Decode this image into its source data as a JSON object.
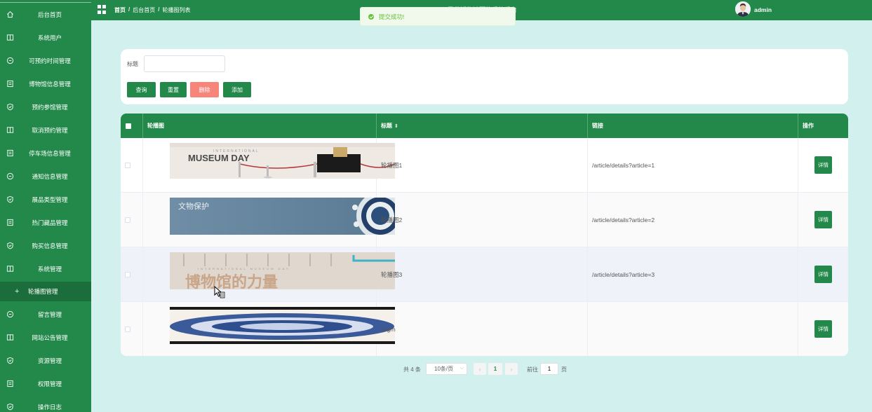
{
  "app": {
    "site_title": "民俗博物馆预约系统后台",
    "user": "admin"
  },
  "breadcrumb": [
    "首页",
    "后台首页",
    "轮播图列表"
  ],
  "toast": {
    "message": "提交成功!"
  },
  "sidebar": {
    "items": [
      {
        "label": "后台首页",
        "icon": "home-icon"
      },
      {
        "label": "系统用户",
        "icon": "grid-icon"
      },
      {
        "label": "可预约时间管理",
        "icon": "chat-icon"
      },
      {
        "label": "博物馆信息管理",
        "icon": "doc-icon"
      },
      {
        "label": "预约参馆管理",
        "icon": "shield-icon"
      },
      {
        "label": "取消预约管理",
        "icon": "grid-icon"
      },
      {
        "label": "停车场信息管理",
        "icon": "doc-icon"
      },
      {
        "label": "通知信息管理",
        "icon": "chat-icon"
      },
      {
        "label": "展品类型管理",
        "icon": "shield-icon"
      },
      {
        "label": "热门藏品管理",
        "icon": "doc-icon"
      },
      {
        "label": "购买信息管理",
        "icon": "shield-icon"
      },
      {
        "label": "系统管理",
        "icon": "grid-icon"
      },
      {
        "label": "轮播图管理",
        "icon": "plus-icon",
        "active": true
      },
      {
        "label": "留言管理",
        "icon": "chat-icon"
      },
      {
        "label": "网站公告管理",
        "icon": "grid-icon"
      },
      {
        "label": "资源管理",
        "icon": "shield-icon"
      },
      {
        "label": "权限管理",
        "icon": "doc-icon"
      },
      {
        "label": "操作日志",
        "icon": "shield-icon"
      }
    ]
  },
  "search": {
    "label": "标题",
    "value": "",
    "placeholder": ""
  },
  "buttons": {
    "query": "查询",
    "reset": "重置",
    "delete": "删除",
    "add": "添加"
  },
  "table": {
    "headers": {
      "image": "轮播图",
      "title": "标题",
      "link": "链接",
      "action": "操作"
    },
    "rows": [
      {
        "title": "轮播图1",
        "link": "/article/details?article=1",
        "detail": "详情",
        "image_text": "MUSEUM DAY",
        "image_sub": "INTERNATIONAL"
      },
      {
        "title": "轮播图2",
        "link": "/article/details?article=2",
        "detail": "详情",
        "image_text": "文物保护"
      },
      {
        "title": "轮播图3",
        "link": "/article/details?article=3",
        "detail": "详情",
        "image_text": "博物馆的力量",
        "image_sub": "INTERNATIONAL MUSEUM DAY"
      },
      {
        "title": "fwgrh",
        "link": "",
        "detail": "详情"
      }
    ]
  },
  "pagination": {
    "total": "共 4 条",
    "page_size": "10条/页",
    "current": "1",
    "goto_label": "前往",
    "goto_value": "1",
    "page_unit": "页"
  },
  "colors": {
    "primary": "#22894a",
    "danger": "#f7857a",
    "background": "#d1f0ee",
    "success_toast": "#67c23a"
  }
}
